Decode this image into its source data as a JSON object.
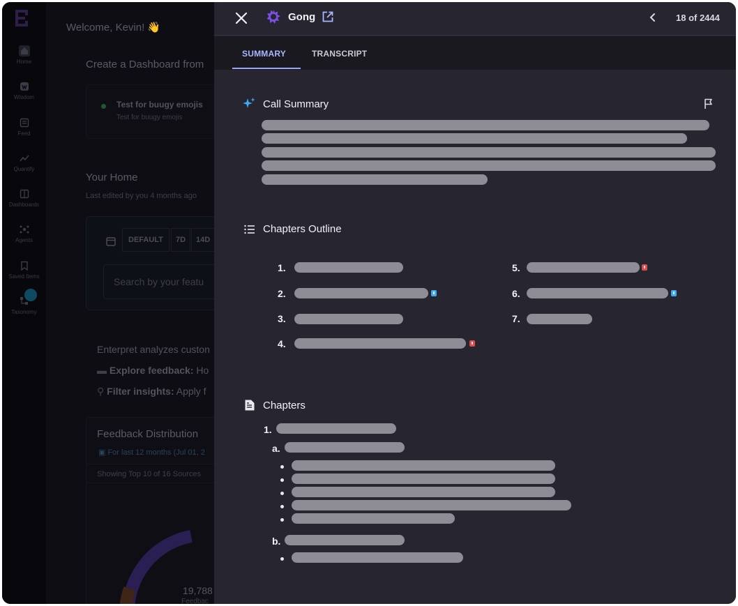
{
  "background": {
    "welcome": "Welcome, Kevin! 👋",
    "create_dashboard": "Create a Dashboard from",
    "test_title": "Test for buugy emojis",
    "test_sub": "Test for buugy emojis",
    "your_home": "Your Home",
    "last_edited": "Last edited by you 4 months ago",
    "range_default": "DEFAULT",
    "range_7d": "7D",
    "range_14d": "14D",
    "search_placeholder": "Search by your featu",
    "analyzes": "Enterpret analyzes custon",
    "explore_label": "Explore feedback:",
    "explore_rest": "Ho",
    "filter_label": "Filter insights:",
    "filter_rest": "Apply f",
    "feedback_dist": "Feedback Distribution",
    "for_last": "For last 12 months (Jul 01, 2",
    "showing": "Showing Top 10 of 16 Sources",
    "donut_total": "19,788",
    "donut_label": "Feedbac"
  },
  "sidebar": {
    "items": [
      {
        "label": "Home"
      },
      {
        "label": "Wisdom"
      },
      {
        "label": "Feed"
      },
      {
        "label": "Quantify"
      },
      {
        "label": "Dashboards"
      },
      {
        "label": "Agents"
      },
      {
        "label": "Saved Items"
      },
      {
        "label": "Taxonomy"
      }
    ]
  },
  "drawer": {
    "title": "Gong",
    "counter": "18 of 2444",
    "tabs": [
      "SUMMARY",
      "TRANSCRIPT"
    ],
    "active_tab": "SUMMARY",
    "call_summary_title": "Call Summary",
    "chapters_outline_title": "Chapters Outline",
    "chapters_title": "Chapters",
    "outline_numbers": [
      "1.",
      "2.",
      "3.",
      "4.",
      "5.",
      "6.",
      "7."
    ],
    "chapter_numbers": [
      "1."
    ],
    "sub_letters": [
      "a.",
      "b."
    ]
  },
  "colors": {
    "accent": "#98a8ff",
    "flag_red": "#e04b4b",
    "flag_blue": "#3fa9f5",
    "gong_purple": "#7b4fe0"
  }
}
